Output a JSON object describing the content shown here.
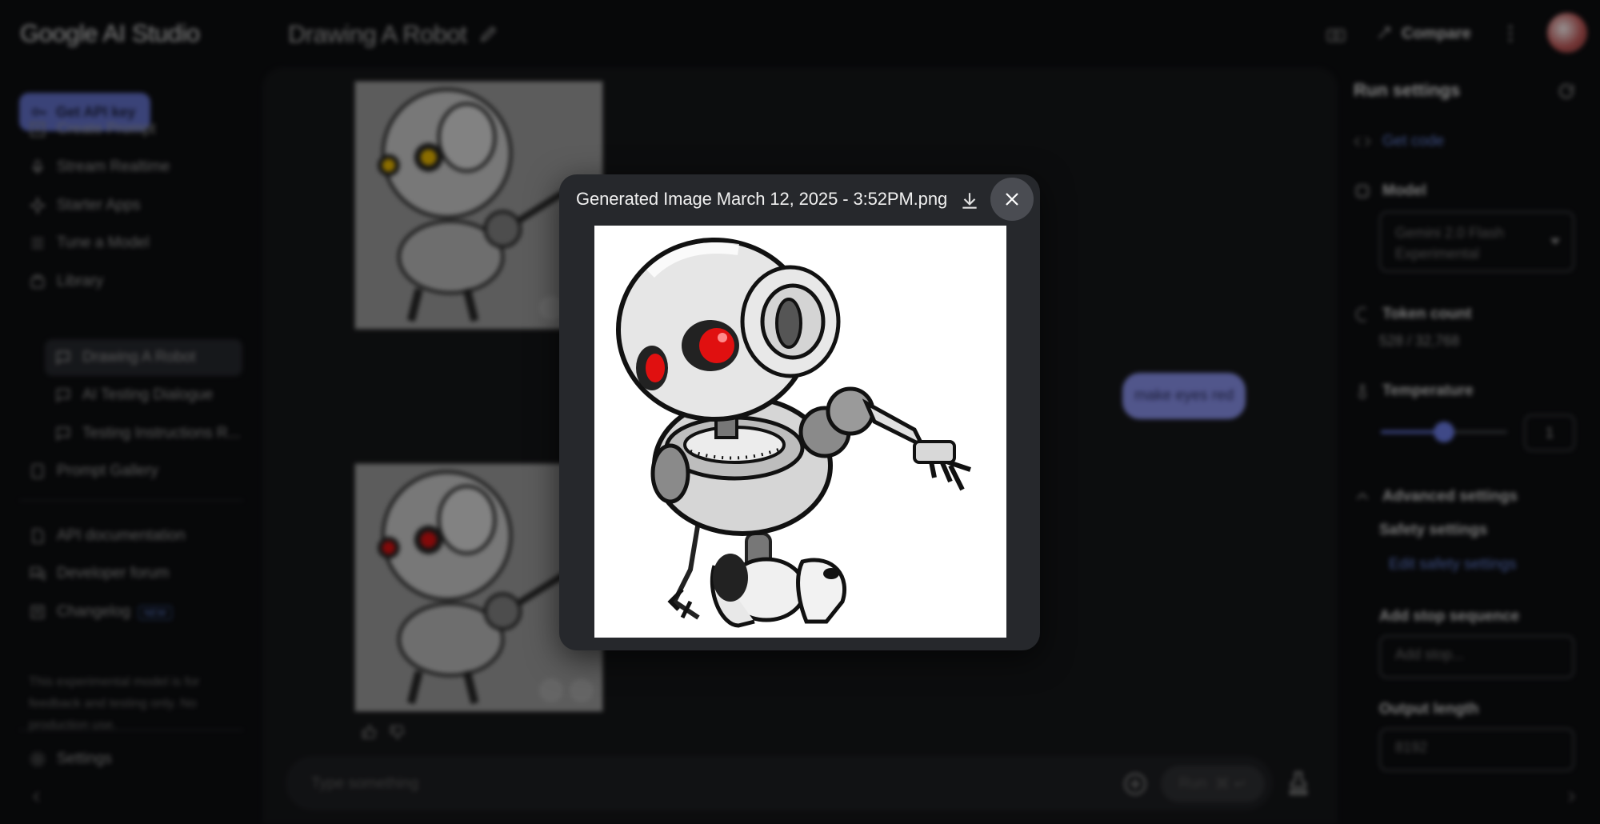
{
  "app": {
    "brand": "Google AI Studio",
    "title": "Drawing A Robot"
  },
  "header": {
    "compare_label": "Compare"
  },
  "sidebar": {
    "api_key_label": "Get API key",
    "items": [
      {
        "label": "Create Prompt"
      },
      {
        "label": "Stream Realtime"
      },
      {
        "label": "Starter Apps"
      },
      {
        "label": "Tune a Model"
      },
      {
        "label": "Library"
      }
    ],
    "library": [
      {
        "label": "Drawing A Robot"
      },
      {
        "label": "AI Testing Dialogue"
      },
      {
        "label": "Testing Instructions R..."
      }
    ],
    "gallery_label": "Prompt Gallery",
    "resources": [
      {
        "label": "API documentation"
      },
      {
        "label": "Developer forum"
      },
      {
        "label": "Changelog"
      }
    ],
    "new_badge": "NEW",
    "note": "This experimental model is for feedback and testing only. No production use.",
    "settings_label": "Settings"
  },
  "chat": {
    "user_message": "make eyes red",
    "input_placeholder": "Type something",
    "run_label": "Run",
    "run_shortcut": "⌘ ↵"
  },
  "run_settings": {
    "title": "Run settings",
    "get_code": "Get code",
    "model_label": "Model",
    "model_value": "Gemini 2.0 Flash Experimental",
    "token_label": "Token count",
    "token_value": "528 / 32,768",
    "temperature_label": "Temperature",
    "temperature_value": "1",
    "temperature_fraction": 0.5,
    "advanced_label": "Advanced settings",
    "safety_label": "Safety settings",
    "safety_link": "Edit safety settings",
    "stop_label": "Add stop sequence",
    "stop_placeholder": "Add stop...",
    "output_label": "Output length",
    "output_value": "8192"
  },
  "modal": {
    "filename": "Generated Image March 12, 2025 - 3:52PM.png"
  },
  "colors": {
    "accent": "#5a67b8",
    "robot_eye": "#e01010",
    "robot_eye_old": "#e0b000"
  }
}
